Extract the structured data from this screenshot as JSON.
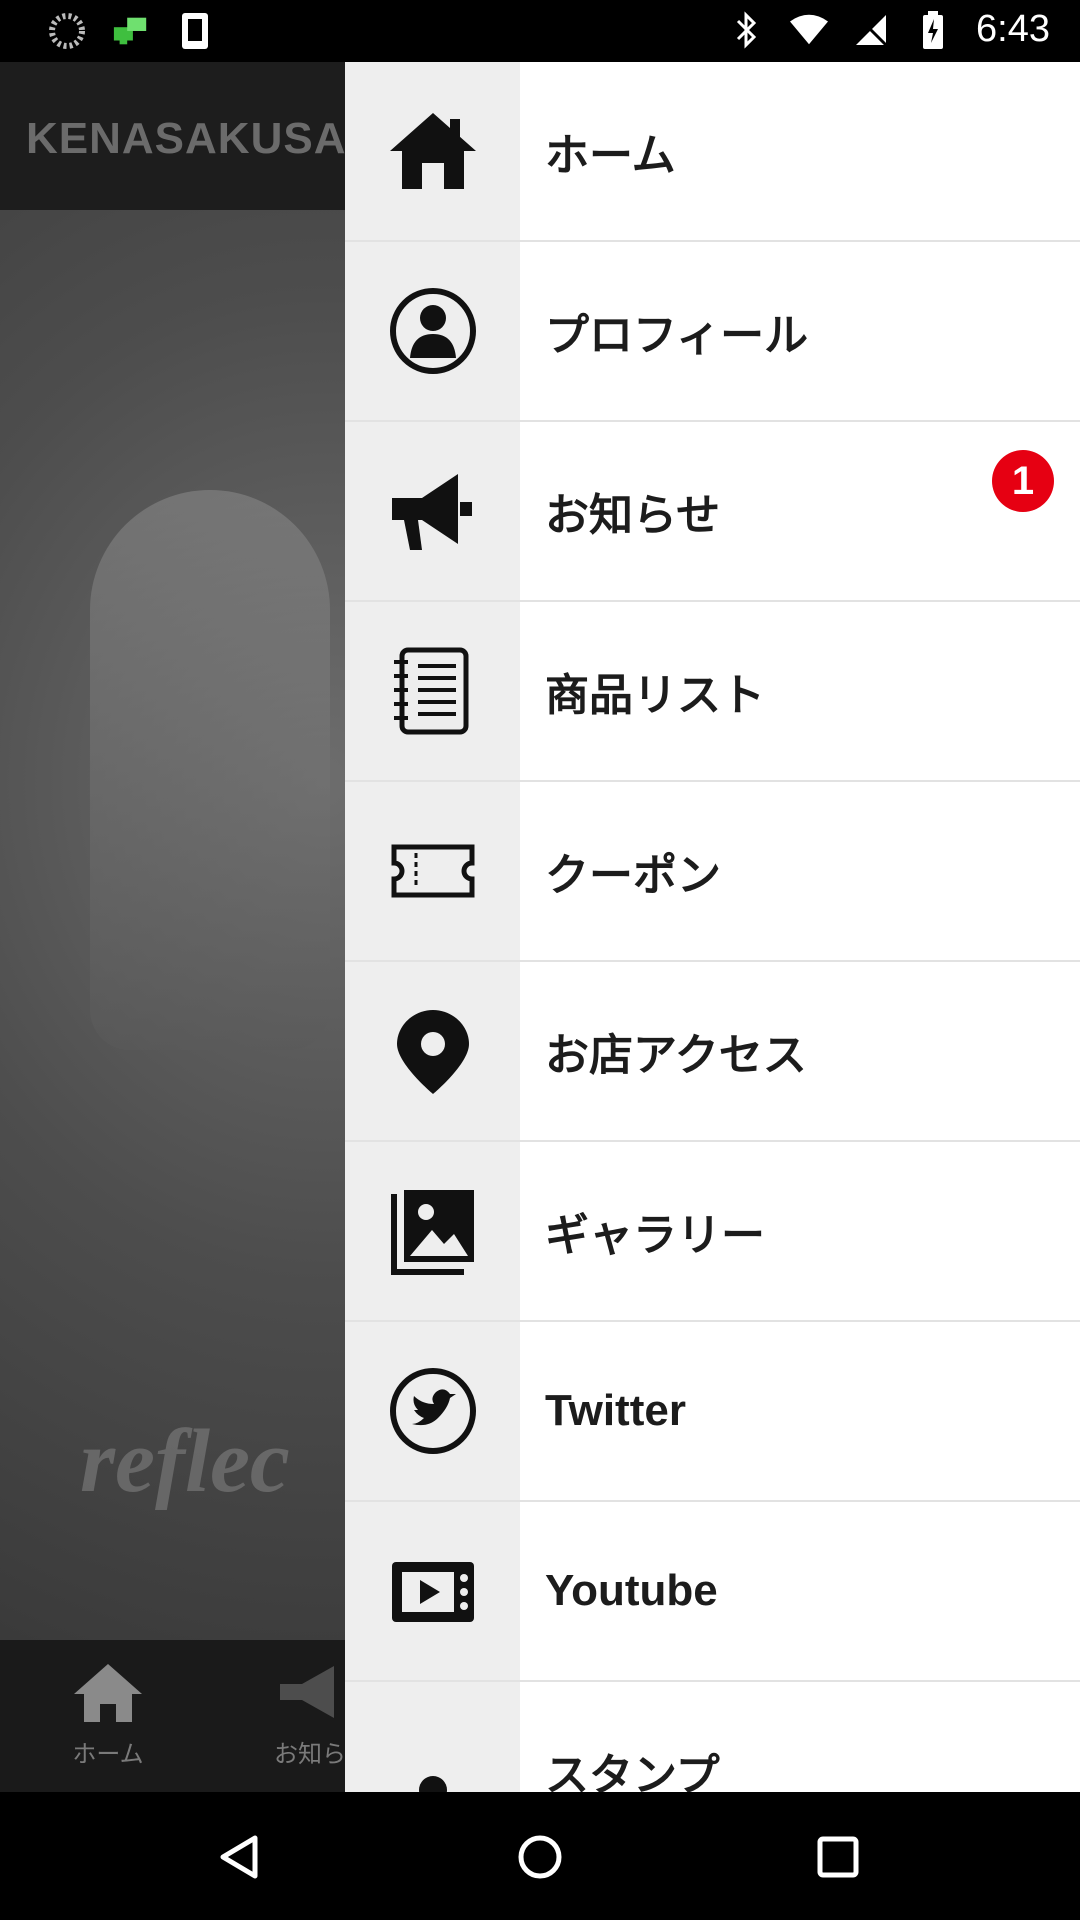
{
  "status_bar": {
    "time": "6:43",
    "icons": [
      "spinner-icon",
      "network-icon",
      "sim-icon",
      "bluetooth-icon",
      "wifi-icon",
      "no-sim-icon",
      "battery-charging-icon"
    ]
  },
  "app": {
    "title": "KENASAKUSA",
    "hero_text": "reflec",
    "bottom_nav": [
      {
        "label": "ホーム",
        "icon": "home-icon"
      },
      {
        "label": "お知ら",
        "icon": "megaphone-icon"
      }
    ]
  },
  "drawer": {
    "items": [
      {
        "label": "ホーム",
        "icon": "home-icon"
      },
      {
        "label": "プロフィール",
        "icon": "profile-icon"
      },
      {
        "label": "お知らせ",
        "icon": "megaphone-icon",
        "badge": "1"
      },
      {
        "label": "商品リスト",
        "icon": "notebook-icon"
      },
      {
        "label": "クーポン",
        "icon": "ticket-icon"
      },
      {
        "label": "お店アクセス",
        "icon": "map-pin-icon"
      },
      {
        "label": "ギャラリー",
        "icon": "gallery-icon"
      },
      {
        "label": "Twitter",
        "icon": "twitter-icon"
      },
      {
        "label": "Youtube",
        "icon": "youtube-icon"
      },
      {
        "label": "スタンプ",
        "icon": "stamp-icon"
      }
    ]
  },
  "colors": {
    "badge": "#e60012",
    "drawer_bg": "#ffffff",
    "icon_column_bg": "#eeeeee",
    "scrim_title": "#6b6b6b"
  }
}
